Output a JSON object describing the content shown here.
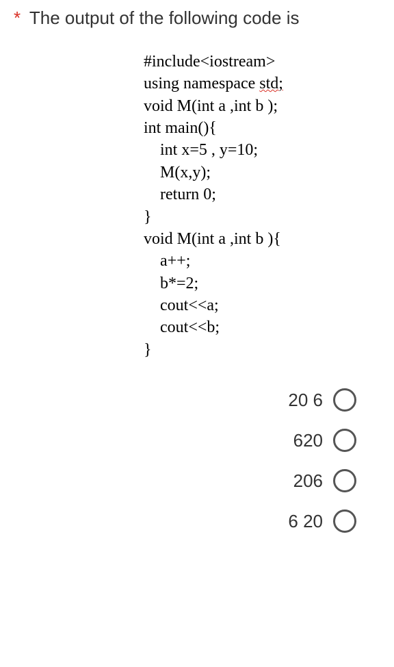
{
  "question": {
    "required_marker": "*",
    "text": "The output of the following code is"
  },
  "code": {
    "lines": [
      "#include<iostream>",
      "using namespace ",
      "void M(int a ,int b );",
      "int main(){",
      "    int x=5 , y=10;",
      "    M(x,y);",
      "    return 0;",
      "}",
      "void M(int a ,int b ){",
      "    a++;",
      "    b*=2;",
      "    cout<<a;",
      "    cout<<b;",
      "}"
    ],
    "std_token": "std;"
  },
  "options": [
    {
      "label": "20 6"
    },
    {
      "label": "620"
    },
    {
      "label": "206"
    },
    {
      "label": "6 20"
    }
  ]
}
